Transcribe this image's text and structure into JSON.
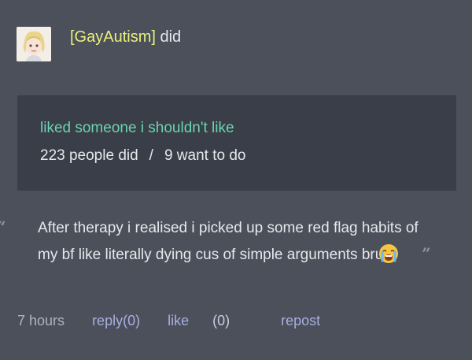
{
  "header": {
    "username": "[GayAutism]",
    "verb": "did"
  },
  "card": {
    "title": "liked someone i shouldn't like",
    "people_did": "223 people did",
    "separator": "/",
    "want_to_do": "9 want to do"
  },
  "post": {
    "open_quote": "“",
    "text": "After therapy i realised i picked up some red flag habits of my bf like literally dying cus of simple arguments bruh",
    "emoji": "crying-face-emoji",
    "close_quote": "”"
  },
  "footer": {
    "time": "7 hours",
    "reply_label": "reply(0)",
    "like_label": "like",
    "like_count": "(0)",
    "repost_label": "repost"
  },
  "colors": {
    "background": "#4b505b",
    "card_background": "#3a3e48",
    "username": "#e8f07a",
    "title_accent": "#6cd3b0",
    "link": "#a8aedf"
  }
}
